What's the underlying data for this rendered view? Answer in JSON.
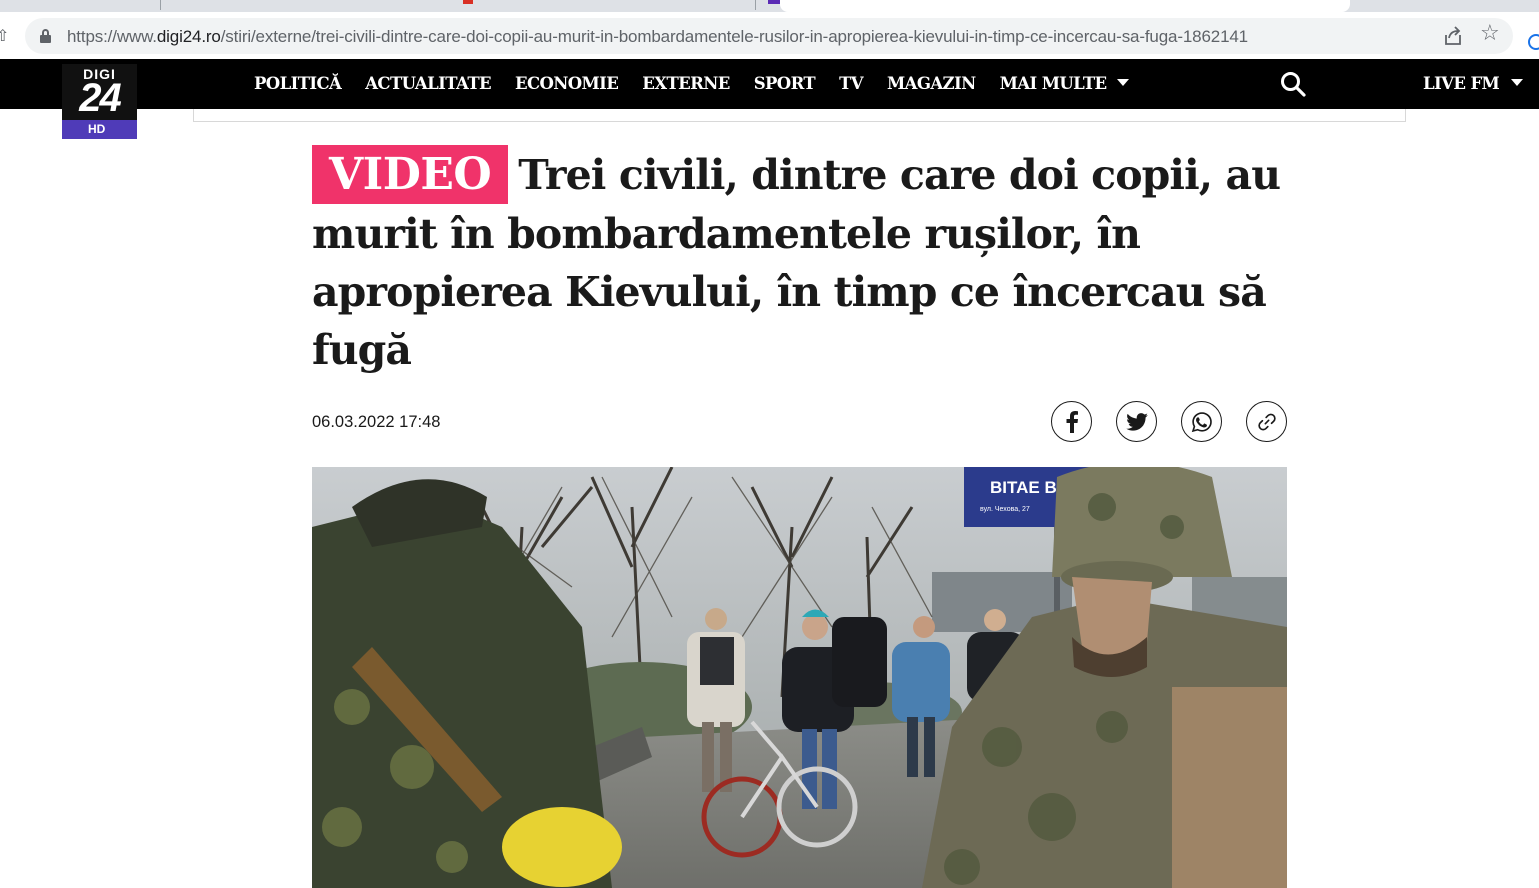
{
  "browser": {
    "url_prefix": "https://www.",
    "url_host": "digi24.ro",
    "url_path": "/stiri/externe/trei-civili-dintre-care-doi-copii-au-murit-in-bombardamentele-rusilor-in-apropierea-kievului-in-timp-ce-incercau-sa-fuga-1862141"
  },
  "logo": {
    "top": "DIGI",
    "number": "24",
    "badge": "HD"
  },
  "nav": {
    "items": [
      "POLITICĂ",
      "ACTUALITATE",
      "ECONOMIE",
      "EXTERNE",
      "SPORT",
      "TV",
      "MAGAZIN",
      "MAI MULTE"
    ],
    "live": "LIVE FM"
  },
  "article": {
    "badge": "VIDEO",
    "title": "Trei civili, dintre care doi copii, au murit în bombardamentele rușilor, în apropierea Kievului, în timp ce încercau să fugă",
    "date": "06.03.2022 17:48",
    "share": [
      "facebook-icon",
      "twitter-icon",
      "whatsapp-icon",
      "link-icon"
    ]
  },
  "photo": {
    "sign_text": "BITAE B IP",
    "sign_sub": "вул. Чехова, 27"
  },
  "colors": {
    "accent": "#f0336a",
    "nav_bg": "#000000",
    "logo_hd": "#4f3bb8"
  }
}
